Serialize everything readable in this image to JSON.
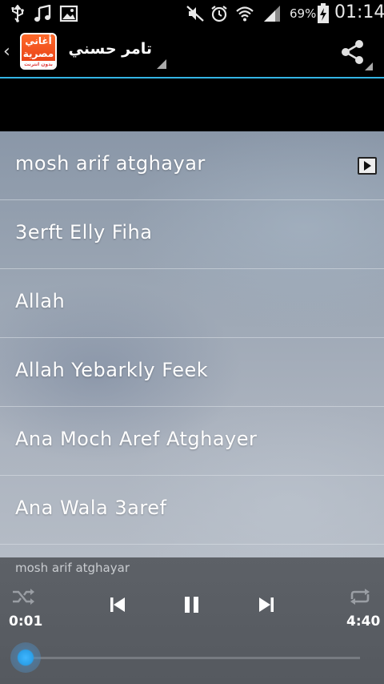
{
  "status_bar": {
    "battery_percent": "69%",
    "time": "01:14",
    "icons": [
      "usb-icon",
      "music-note-icon",
      "image-icon",
      "mute-icon",
      "alarm-icon",
      "wifi-icon",
      "signal-icon",
      "battery-charging-icon"
    ]
  },
  "action_bar": {
    "back_glyph": "‹",
    "app_icon_line1": "أغاني",
    "app_icon_line2": "مصرية",
    "app_icon_line3": "بدون انترنت",
    "title": "تامر حسني",
    "share_icon": "share-icon",
    "accent_color": "#33b5e5"
  },
  "songs": [
    {
      "title": "mosh arif atghayar",
      "playing": true
    },
    {
      "title": "3erft Elly Fiha",
      "playing": false
    },
    {
      "title": "Allah",
      "playing": false
    },
    {
      "title": "Allah Yebarkly Feek",
      "playing": false
    },
    {
      "title": "Ana Moch Aref Atghayer",
      "playing": false
    },
    {
      "title": "Ana Wala 3aref",
      "playing": false
    }
  ],
  "player": {
    "now_playing": "mosh arif atghayar",
    "elapsed": "0:01",
    "duration": "4:40",
    "progress_fraction": 0.0036,
    "controls": [
      "shuffle-icon",
      "previous-icon",
      "pause-icon",
      "next-icon",
      "repeat-icon"
    ],
    "seek_color": "#2a9fe8"
  }
}
